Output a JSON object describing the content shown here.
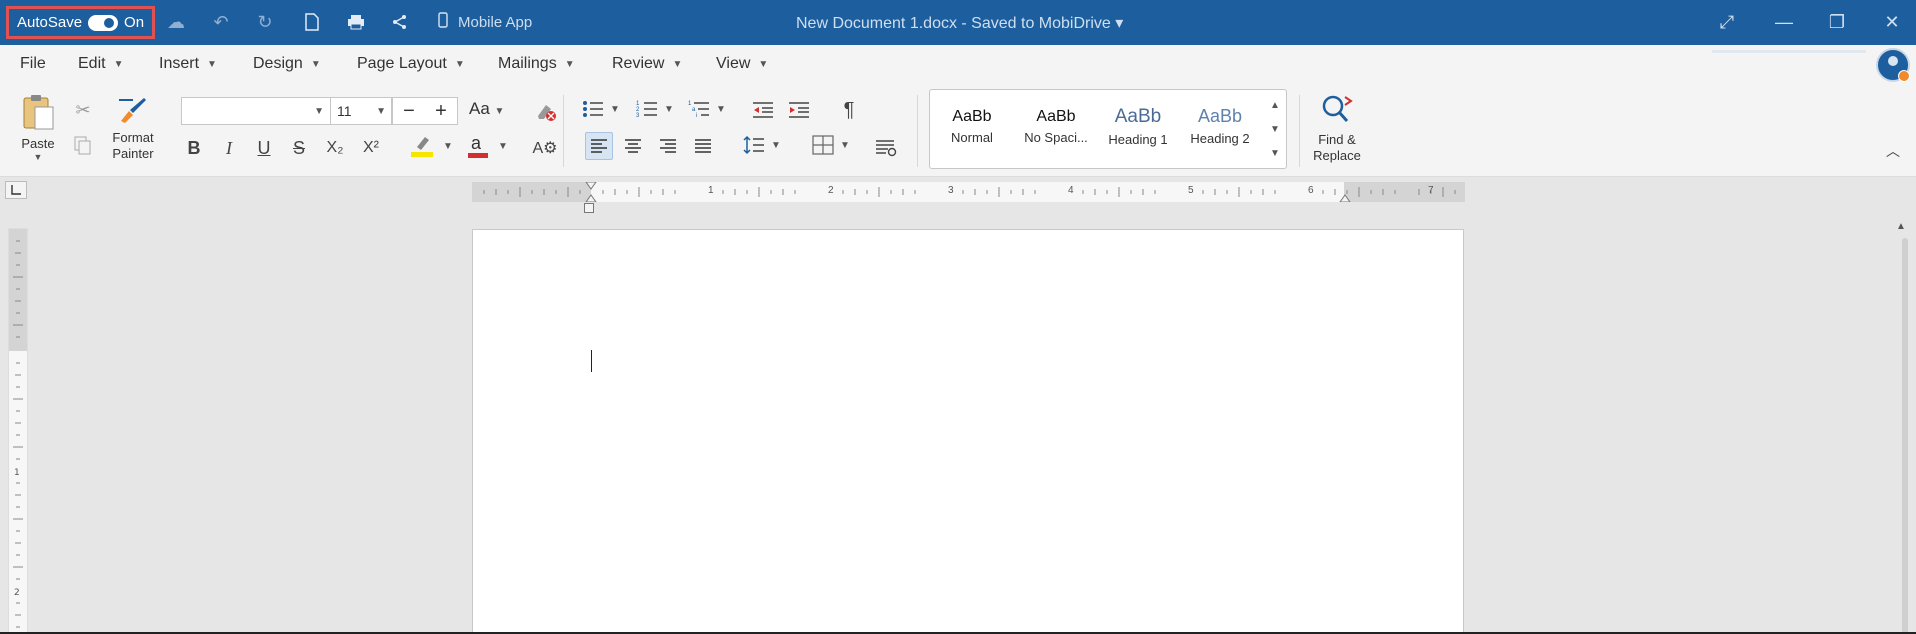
{
  "titlebar": {
    "autosave_label": "AutoSave",
    "autosave_state": "On",
    "mobile_app": "Mobile App",
    "document_title": "New Document 1.docx - Saved to MobiDrive ▾"
  },
  "menu": {
    "items": [
      "File",
      "Edit",
      "Insert",
      "Design",
      "Page Layout",
      "Mailings",
      "Review",
      "View"
    ]
  },
  "ribbon": {
    "paste": "Paste",
    "format_painter": "Format Painter",
    "font_name": "",
    "font_size": "11",
    "case_label": "Aa",
    "bold": "B",
    "italic": "I",
    "underline": "U",
    "strike": "S",
    "subscript": "X₂",
    "superscript": "X²",
    "pilcrow": "¶",
    "styles": [
      {
        "sample": "AaBb",
        "name": "Normal"
      },
      {
        "sample": "AaBb",
        "name": "No Spaci..."
      },
      {
        "sample": "AaBb",
        "name": "Heading 1"
      },
      {
        "sample": "AaBb",
        "name": "Heading 2"
      }
    ],
    "find_replace_line1": "Find &",
    "find_replace_line2": "Replace"
  },
  "ruler": {
    "numbers": [
      "1",
      "2",
      "3",
      "4",
      "5",
      "6",
      "7"
    ]
  },
  "colors": {
    "titlebar_bg": "#1d5e9e",
    "autosave_border": "#e05252",
    "highlight_yellow": "#f5e600",
    "font_color_red": "#d32f2f"
  }
}
